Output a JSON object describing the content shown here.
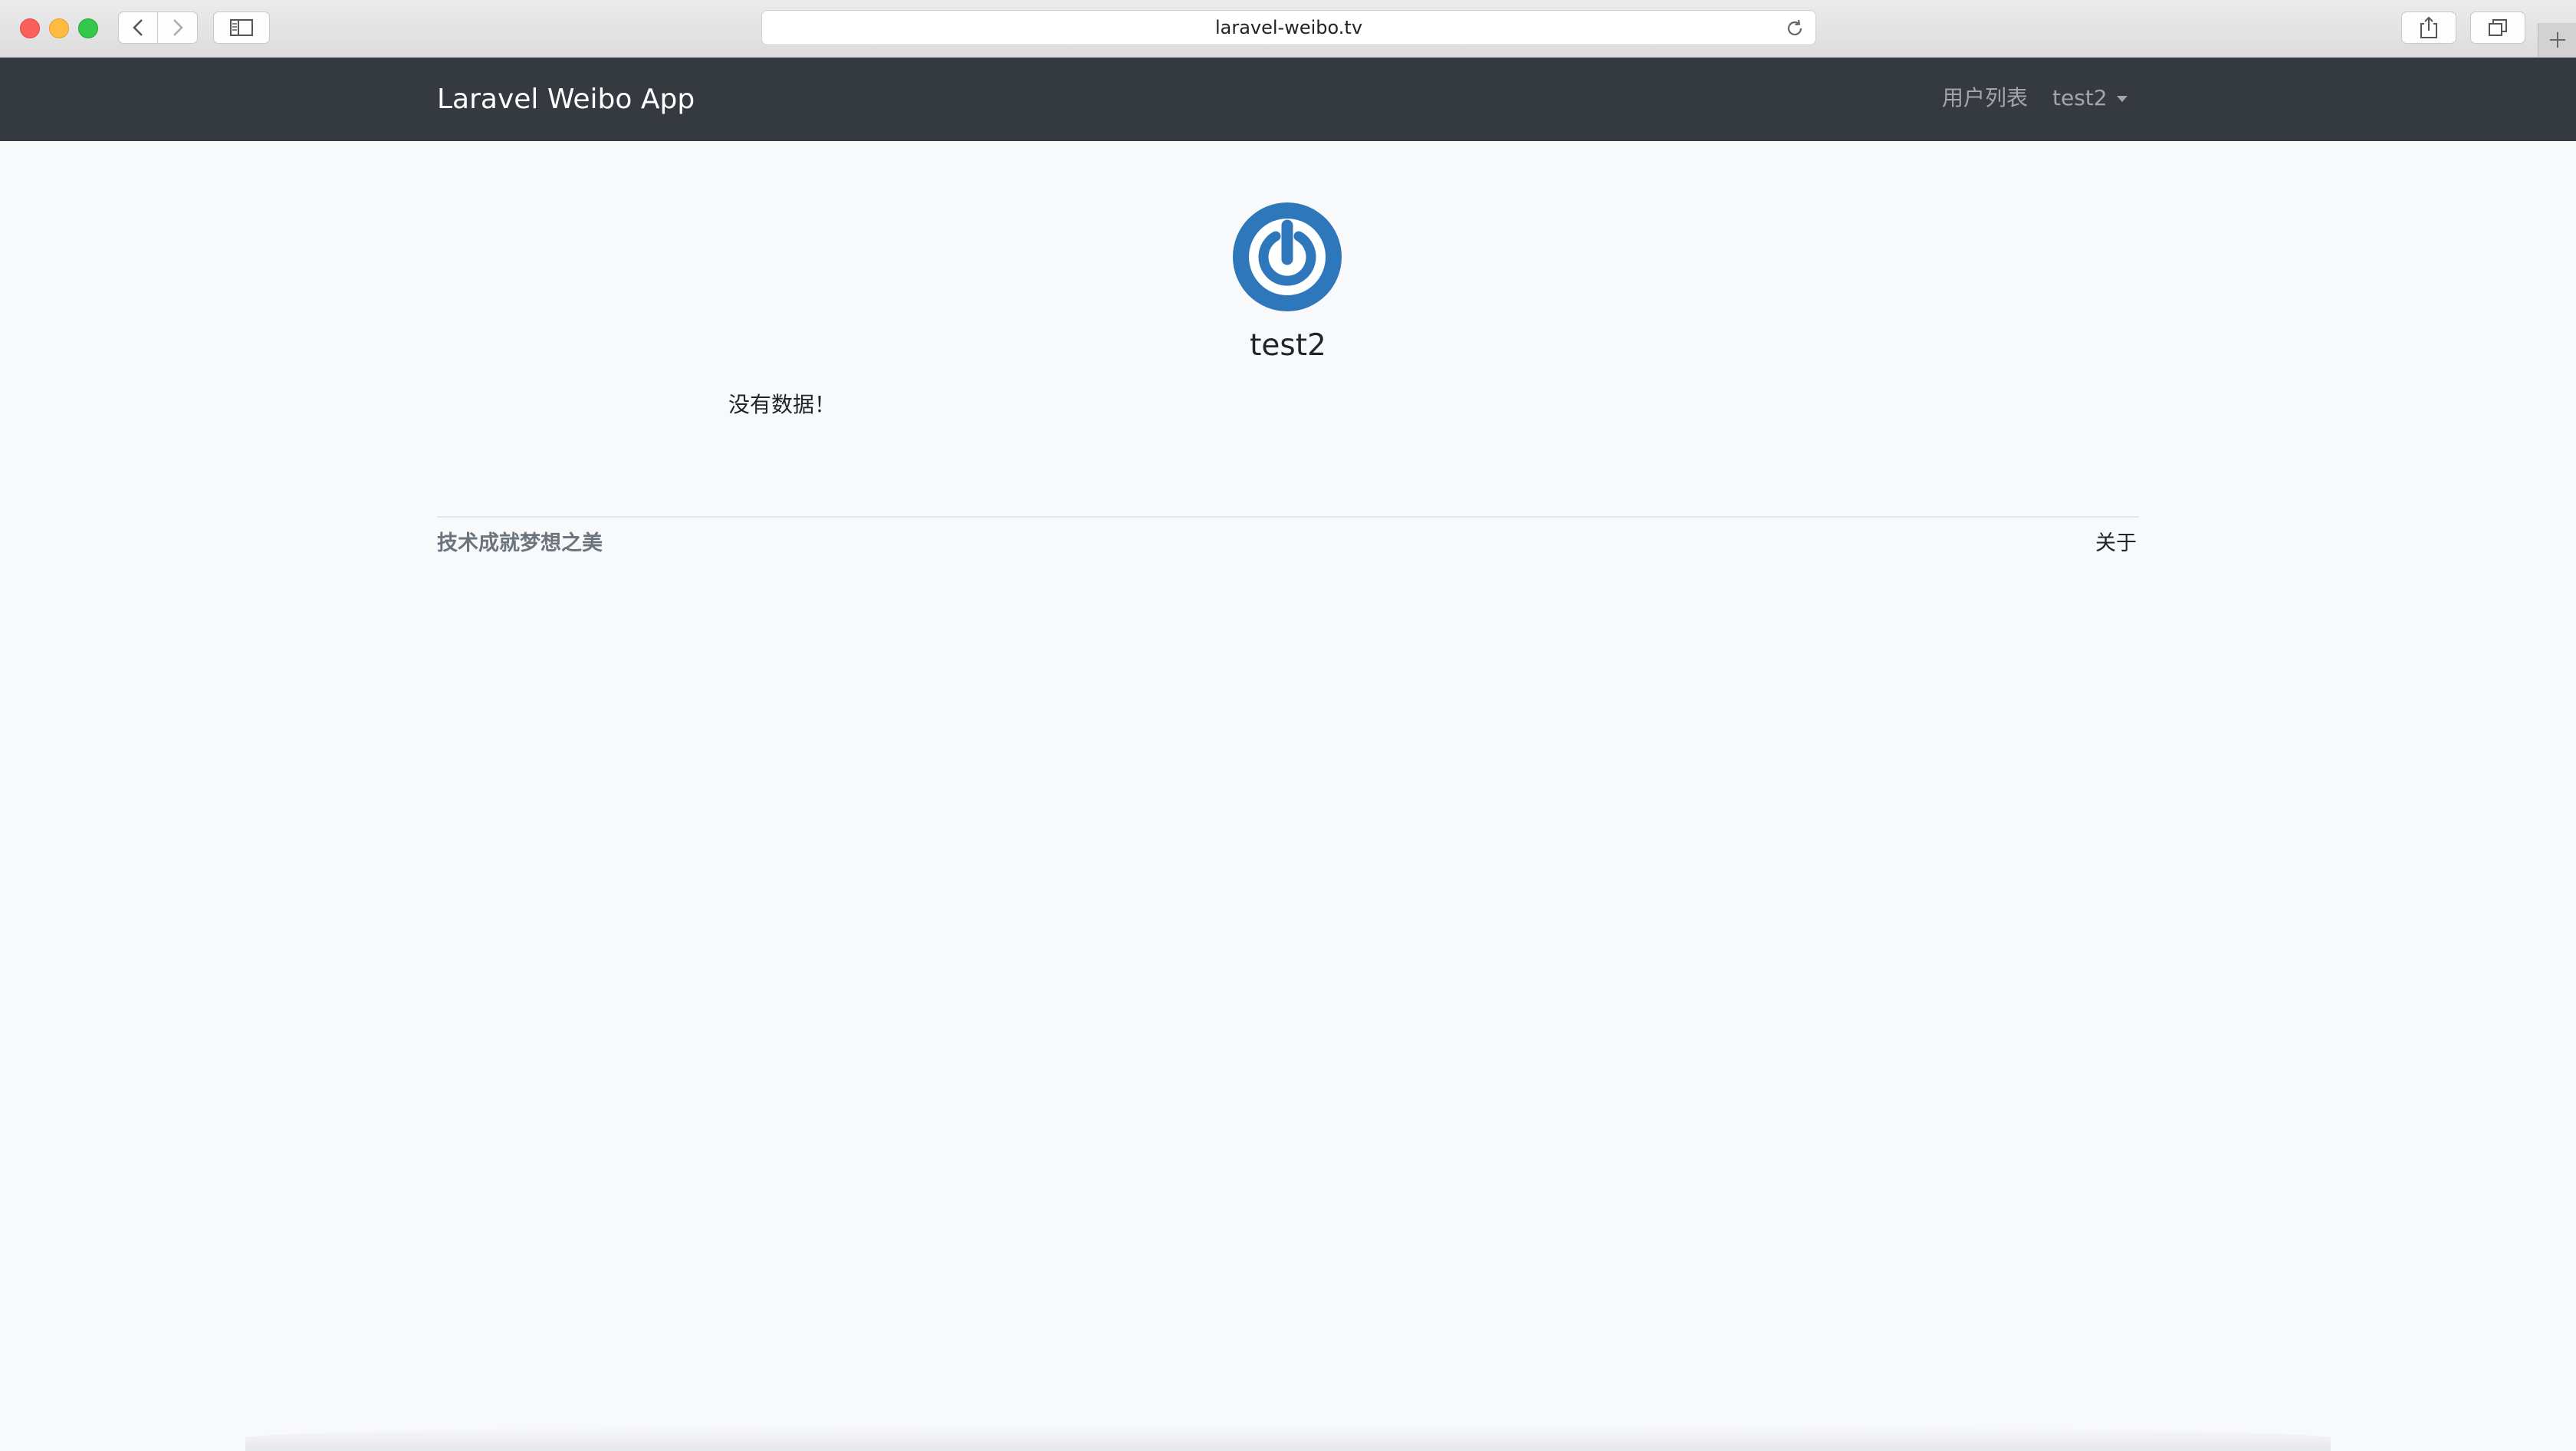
{
  "browser": {
    "url": "laravel-weibo.tv",
    "icons": [
      "back-icon",
      "forward-icon",
      "sidebar-icon",
      "reload-icon",
      "share-icon",
      "tabs-icon",
      "plus-icon"
    ]
  },
  "navbar": {
    "brand": "Laravel Weibo App",
    "users_link": "用户列表",
    "user_menu": "test2"
  },
  "profile": {
    "username": "test2",
    "avatar_icon": "gravatar-power-icon",
    "avatar_color": "#2e77bb",
    "empty_message": "没有数据！"
  },
  "footer": {
    "slogan": "技术成就梦想之美",
    "about": "关于"
  },
  "colors": {
    "navbar_bg": "#343a40",
    "page_bg": "#f8f9fb"
  }
}
